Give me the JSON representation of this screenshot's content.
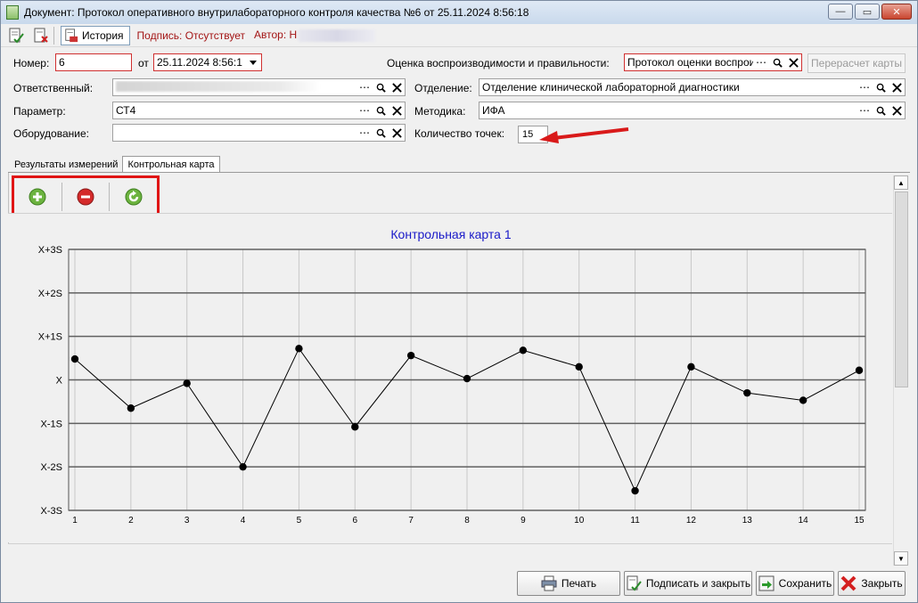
{
  "window": {
    "title": "Документ: Протокол оперативного внутрилабораторного контроля качества №6 от 25.11.2024 8:56:18",
    "minimize": "—",
    "maximize": "▭",
    "close": "✕"
  },
  "toolbar": {
    "history_label": "История",
    "signature_label": "Подпись: Отсутствует",
    "author_label": "Автор: Н"
  },
  "form": {
    "number_label": "Номер:",
    "number_value": "6",
    "from_label": "от",
    "date_value": "25.11.2024 8:56:1",
    "assessment_label": "Оценка воспроизводимости и правильности:",
    "assessment_value": "Протокол оценки воспрои",
    "recalc_label": "Перерасчет карты",
    "responsible_label": "Ответственный:",
    "responsible_value": "",
    "department_label": "Отделение:",
    "department_value": "Отделение клинической лабораторной диагностики",
    "parameter_label": "Параметр:",
    "parameter_value": "СТ4",
    "method_label": "Методика:",
    "method_value": "ИФА",
    "equipment_label": "Оборудование:",
    "equipment_value": "",
    "points_label": "Количество точек:",
    "points_value": "15"
  },
  "tabs": [
    {
      "label": "Результаты измерений"
    },
    {
      "label": "Контрольная карта"
    }
  ],
  "buttons": {
    "print": "Печать",
    "sign_close": "Подписать и закрыть",
    "save": "Сохранить",
    "close": "Закрыть"
  },
  "icons": {
    "add": "plus-circle-icon",
    "remove": "minus-circle-icon",
    "refresh": "refresh-icon"
  },
  "colors": {
    "accent_red": "#e01515",
    "chart_title": "#1a1ac8",
    "add_green": "#6cb33f",
    "remove_red": "#d42a2a"
  },
  "chart_data": {
    "type": "line",
    "title": "Контрольная карта 1",
    "x": [
      1,
      2,
      3,
      4,
      5,
      6,
      7,
      8,
      9,
      10,
      11,
      12,
      13,
      14,
      15
    ],
    "y_levels": [
      "X-3S",
      "X-2S",
      "X-1S",
      "X",
      "X+1S",
      "X+2S",
      "X+3S"
    ],
    "ylim": [
      -3,
      3
    ],
    "series": [
      {
        "values": [
          0.48,
          -0.65,
          -0.08,
          -2.0,
          0.72,
          -1.08,
          0.56,
          0.03,
          0.68,
          0.3,
          -2.55,
          0.3,
          -0.3,
          -0.47,
          0.22
        ]
      }
    ],
    "grid": true
  }
}
